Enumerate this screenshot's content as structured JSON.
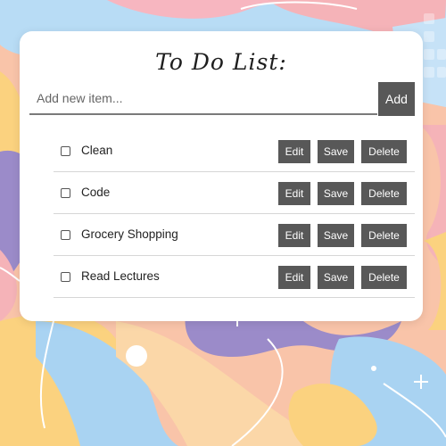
{
  "header": {
    "title": "To Do List:"
  },
  "new_item": {
    "placeholder": "Add new item...",
    "value": "",
    "add_label": "Add"
  },
  "todos": [
    {
      "label": "Clean",
      "checked": false
    },
    {
      "label": "Code",
      "checked": false
    },
    {
      "label": "Grocery Shopping",
      "checked": false
    },
    {
      "label": "Read Lectures",
      "checked": false
    }
  ],
  "actions": {
    "edit_label": "Edit",
    "save_label": "Save",
    "delete_label": "Delete"
  },
  "colors": {
    "button_bg": "#585858",
    "card_bg": "#ffffff",
    "bg_peach": "#f7c9b4",
    "bg_blue": "#a9d3f2",
    "bg_purple": "#9b8bc9",
    "bg_yellow": "#fbd27f",
    "bg_pink": "#f5b3b8"
  }
}
